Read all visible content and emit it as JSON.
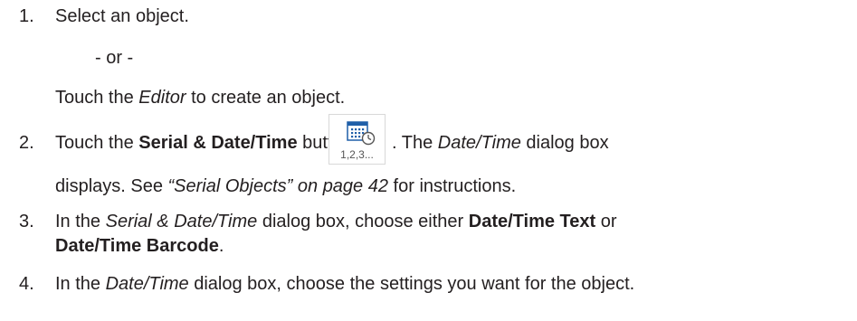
{
  "steps": [
    {
      "number": "1.",
      "text": "Select an object.",
      "or_text": "- or -",
      "alt_pre": "Touch the ",
      "alt_italic": "Editor",
      "alt_post": " to create an object."
    },
    {
      "number": "2.",
      "pre": "Touch the ",
      "bold": "Serial & Date/Time",
      "mid": " button",
      "post": ". The ",
      "italic": "Date/Time",
      "post2": " dialog box",
      "line2_pre": "displays. See ",
      "line2_italic": "“Serial Objects” on page 42",
      "line2_post": " for instructions.",
      "icon": {
        "name": "serial-date-time-icon",
        "caption": "1,2,3...",
        "accent": "#1f5fa8"
      }
    },
    {
      "number": "3.",
      "pre": "In the ",
      "italic": "Serial & Date/Time",
      "mid": " dialog box, choose either ",
      "bold1": "Date/Time Text",
      "post": " or",
      "bold2": "Date/Time Barcode",
      "end": "."
    },
    {
      "number": "4.",
      "pre": "In the ",
      "italic": "Date/Time",
      "post": " dialog box, choose the settings you want for the object."
    }
  ]
}
